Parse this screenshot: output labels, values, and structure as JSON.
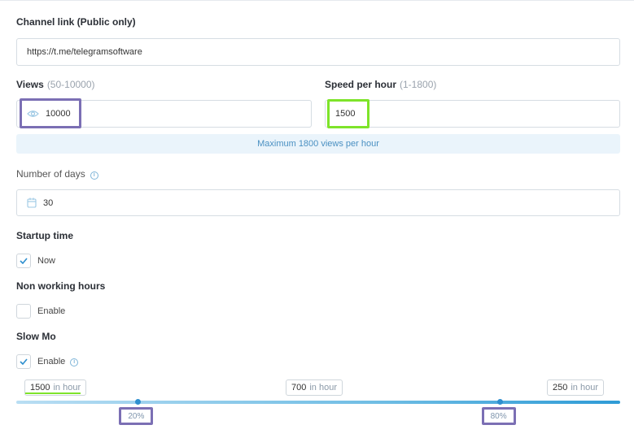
{
  "channel": {
    "label": "Channel link (Public only)",
    "value": "https://t.me/telegramsoftware"
  },
  "views": {
    "label": "Views",
    "hint": "(50-10000)",
    "value": "10000",
    "icon": "eye-icon"
  },
  "speed": {
    "label": "Speed per hour",
    "hint": "(1-1800)",
    "value": "1500"
  },
  "notice": "Maximum 1800 views per hour",
  "days": {
    "label": "Number of days",
    "value": "30",
    "icon": "calendar-icon"
  },
  "startup": {
    "label": "Startup time",
    "option_label": "Now",
    "checked": true
  },
  "non_working": {
    "label": "Non working hours",
    "option_label": "Enable",
    "checked": false
  },
  "slowmo": {
    "label": "Slow Mo",
    "option_label": "Enable",
    "checked": true,
    "tags": [
      {
        "value": "1500",
        "unit": "in hour"
      },
      {
        "value": "700",
        "unit": "in hour"
      },
      {
        "value": "250",
        "unit": "in hour"
      }
    ],
    "handles": [
      {
        "percent": 20,
        "label": "20%"
      },
      {
        "percent": 80,
        "label": "80%"
      }
    ]
  },
  "colors": {
    "accent": "#2e8fcf",
    "highlight_purple": "#7b6fb4",
    "highlight_green": "#7ee42a"
  }
}
